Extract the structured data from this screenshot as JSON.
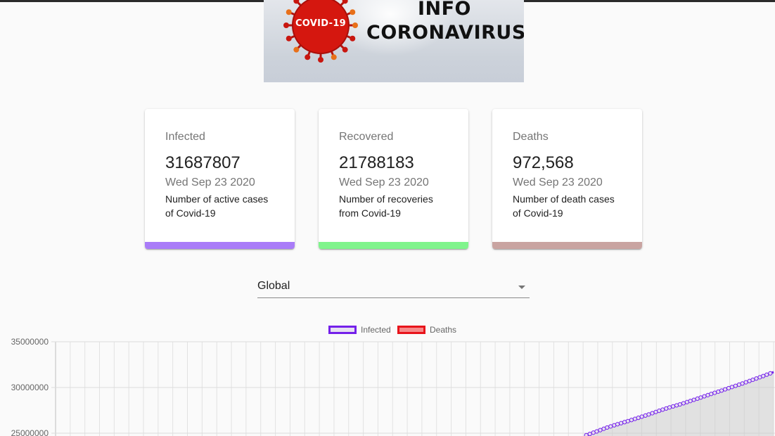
{
  "banner": {
    "virus_label": "COVID-19",
    "title_line1": "INFO",
    "title_line2": "CORONAVIRUS"
  },
  "cards": [
    {
      "title": "Infected",
      "value": "31687807",
      "date": "Wed Sep 23 2020",
      "description": "Number of active cases of Covid-19",
      "bar_color": "#a97cf8"
    },
    {
      "title": "Recovered",
      "value": "21788183",
      "date": "Wed Sep 23 2020",
      "description": "Number of recoveries from Covid-19",
      "bar_color": "#80f48c"
    },
    {
      "title": "Deaths",
      "value": "972,568",
      "date": "Wed Sep 23 2020",
      "description": "Number of death cases of Covid-19",
      "bar_color": "#c9a4a1"
    }
  ],
  "country_select": {
    "selected": "Global"
  },
  "chart_data": {
    "type": "line",
    "legend": [
      {
        "label": "Infected",
        "border": "#7420ea",
        "fill": "#e6e0f0"
      },
      {
        "label": "Deaths",
        "border": "#e8141b",
        "fill": "#f58a8a"
      }
    ],
    "y_ticks": [
      "35000000",
      "30000000",
      "25000000"
    ],
    "y_visible_range": [
      24000000,
      35000000
    ],
    "series": [
      {
        "name": "Infected",
        "points_visible": [
          [
            51,
            24780000
          ],
          [
            52,
            25190000
          ],
          [
            53,
            25620000
          ],
          [
            54,
            25980000
          ],
          [
            55,
            26320000
          ],
          [
            56,
            26680000
          ],
          [
            57,
            27050000
          ],
          [
            58,
            27450000
          ],
          [
            59,
            27820000
          ],
          [
            60,
            28150000
          ],
          [
            61,
            28520000
          ],
          [
            62,
            28900000
          ],
          [
            63,
            29290000
          ],
          [
            64,
            29660000
          ],
          [
            65,
            30050000
          ],
          [
            66,
            30430000
          ],
          [
            67,
            30840000
          ],
          [
            68,
            31250000
          ],
          [
            69,
            31687807
          ]
        ]
      }
    ],
    "x_last_index": 69
  }
}
